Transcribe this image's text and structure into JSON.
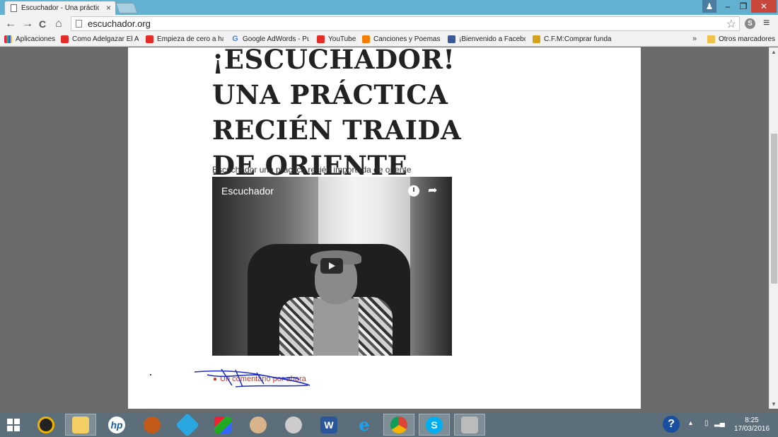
{
  "browser": {
    "tab_title": "Escuchador - Una práctica",
    "tab_close": "×",
    "url": "escuchador.org",
    "controls": {
      "min": "–",
      "max": "❐",
      "close": "✕",
      "user": "♟"
    },
    "ext_skype": "S",
    "menu": "≡",
    "star": "☆"
  },
  "nav": {
    "back": "←",
    "forward": "→",
    "reload": "C",
    "home": "⌂"
  },
  "bookmarks": {
    "items": [
      {
        "label": "Aplicaciones",
        "icon": "apps-icon"
      },
      {
        "label": "Como Adelgazar El Al",
        "icon": "youtube-icon"
      },
      {
        "label": "Empieza de cero a ha",
        "icon": "youtube-icon"
      },
      {
        "label": "Google AdWords - Pu",
        "icon": "google-icon"
      },
      {
        "label": "YouTube",
        "icon": "youtube-icon"
      },
      {
        "label": "Canciones y Poemas",
        "icon": "blogger-icon"
      },
      {
        "label": "¡Bienvenido a Facebo",
        "icon": "facebook-icon"
      },
      {
        "label": "C.F.M:Comprar funda",
        "icon": "cfm-icon"
      }
    ],
    "overflow": "»",
    "other": "Otros marcadores"
  },
  "post": {
    "title": "¡ESCUCHADOR! UNA PRÁCTICA RECIÉN TRAIDA DE ORIENTE",
    "excerpt": "Escuchador una practica recién importada de oriente",
    "video_title": "Escuchador",
    "comment_link": "Un comentario por ahora"
  },
  "taskbar": {
    "apps": [
      "media-icon",
      "file-explorer-icon",
      "hp-icon",
      "glove-icon",
      "rocket-icon",
      "puzzle-icon",
      "paint-icon",
      "network-icon",
      "word-icon",
      "ie-icon",
      "chrome-icon",
      "skype-icon",
      "camera-icon"
    ],
    "help": "?",
    "tray_arrow": "▴",
    "time": "8:25",
    "date": "17/03/2016"
  },
  "colors": {
    "tab_strip": "#62b1d1",
    "taskbar": "#5c6e7a",
    "comment_link": "#c0392b"
  }
}
